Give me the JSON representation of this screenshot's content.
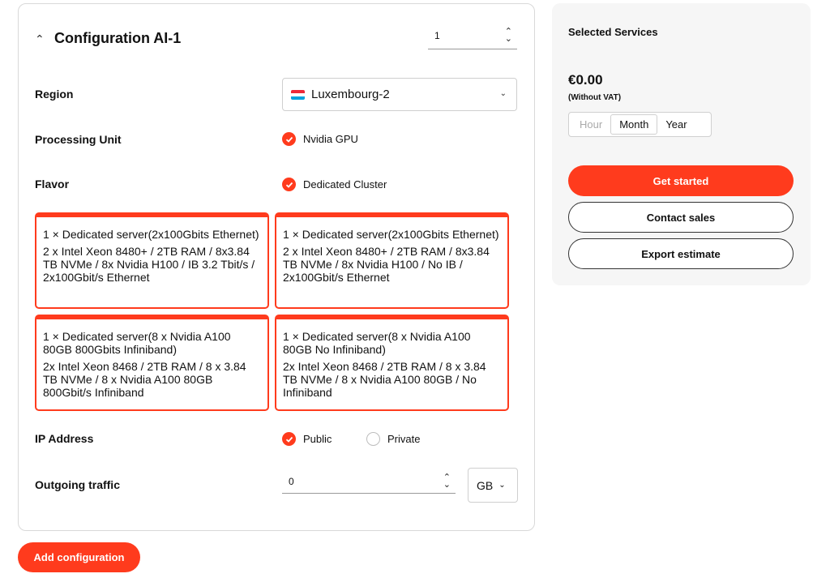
{
  "config": {
    "title": "Configuration AI-1",
    "quantity": "1"
  },
  "labels": {
    "region": "Region",
    "processing_unit": "Processing Unit",
    "flavor": "Flavor",
    "ip_address": "IP Address",
    "outgoing_traffic": "Outgoing traffic"
  },
  "region": {
    "selected": "Luxembourg-2",
    "flag_colors": [
      "#ed2939",
      "#ffffff",
      "#00a1de"
    ]
  },
  "processing_unit": {
    "selected": "Nvidia GPU"
  },
  "flavor": {
    "selected": "Dedicated Cluster"
  },
  "servers": [
    {
      "title": "1 × Dedicated server(2x100Gbits Ethernet)",
      "spec": "2 x Intel Xeon 8480+ / 2TB RAM / 8x3.84 TB NVMe / 8x Nvidia H100 / IB 3.2 Tbit/s / 2x100Gbit/s Ethernet"
    },
    {
      "title": "1 × Dedicated server(2x100Gbits Ethernet)",
      "spec": "2 x Intel Xeon 8480+ / 2TB RAM / 8x3.84 TB NVMe / 8x Nvidia H100 / No IB / 2x100Gbit/s Ethernet"
    },
    {
      "title": "1 × Dedicated server(8 x Nvidia A100 80GB 800Gbits Infiniband)",
      "spec": "2x Intel Xeon 8468 / 2TB RAM / 8 x 3.84 TB NVMe / 8 x Nvidia A100 80GB 800Gbit/s Infiniband"
    },
    {
      "title": "1 × Dedicated server(8 x Nvidia A100 80GB No Infiniband)",
      "spec": "2x Intel Xeon 8468 / 2TB RAM / 8 x 3.84 TB NVMe / 8 x Nvidia A100 80GB / No Infiniband"
    }
  ],
  "ip_address": {
    "public": "Public",
    "private": "Private",
    "selected": "Public"
  },
  "traffic": {
    "value": "0",
    "unit": "GB"
  },
  "add_configuration": "Add configuration",
  "summary": {
    "title": "Selected Services",
    "price": "€0.00",
    "vat_note": "(Without VAT)",
    "periods": [
      "Hour",
      "Month",
      "Year"
    ],
    "selected_period": "Month",
    "get_started": "Get started",
    "contact_sales": "Contact sales",
    "export_estimate": "Export estimate"
  },
  "colors": {
    "accent": "#ff3b1d"
  }
}
